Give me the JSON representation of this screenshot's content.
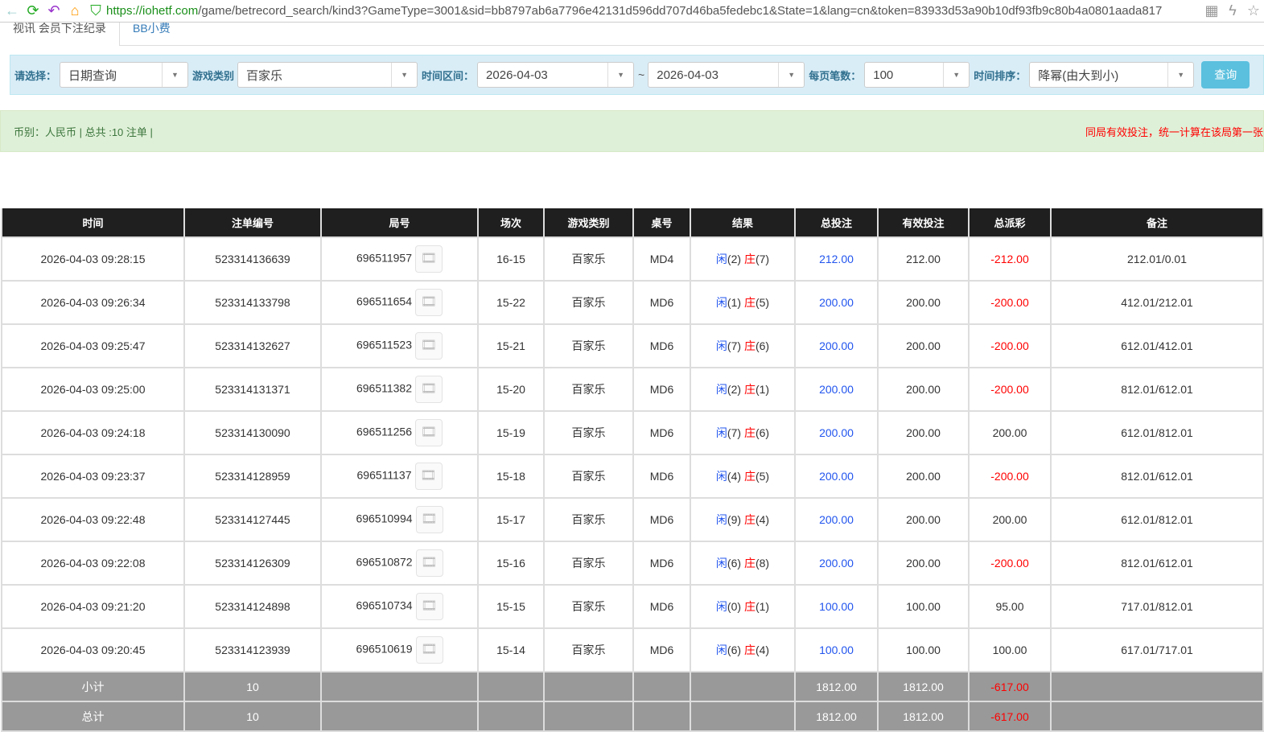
{
  "browser": {
    "url_host": "https://iohetf.com",
    "url_path": "/game/betrecord_search/kind3?GameType=3001&sid=bb8797ab6a7796e42131d596dd707d46ba5fedebc1&State=1&lang=cn&token=83933d53a90b10df93fb9c80b4a0801aada817"
  },
  "tabs": [
    {
      "label": "视讯 会员下注纪录"
    },
    {
      "label": "BB小费"
    }
  ],
  "filter": {
    "select_label": "请选择：",
    "select_value": "日期查询",
    "game_label": "游戏类别",
    "game_value": "百家乐",
    "range_label": "时间区间：",
    "date_from": "2026-04-03",
    "tilde": "~",
    "date_to": "2026-04-03",
    "per_page_label": "每页笔数：",
    "per_page_value": "100",
    "sort_label": "时间排序：",
    "sort_value": "降幂(由大到小)",
    "query_button": "查询"
  },
  "info": {
    "summary": "币别：人民币 | 总共 :10 注单 |",
    "notice": "同局有效投注，统一计算在该局第一张"
  },
  "table": {
    "headers": [
      "时间",
      "注单编号",
      "局号",
      "场次",
      "游戏类别",
      "桌号",
      "结果",
      "总投注",
      "有效投注",
      "总派彩",
      "备注"
    ],
    "rows": [
      [
        "2026-04-03 09:28:15",
        "523314136639",
        "696511957",
        "16-15",
        "百家乐",
        "MD4",
        "2",
        "7",
        "212.00",
        "212.00",
        "-212.00",
        "212.01/0.01"
      ],
      [
        "2026-04-03 09:26:34",
        "523314133798",
        "696511654",
        "15-22",
        "百家乐",
        "MD6",
        "1",
        "5",
        "200.00",
        "200.00",
        "-200.00",
        "412.01/212.01"
      ],
      [
        "2026-04-03 09:25:47",
        "523314132627",
        "696511523",
        "15-21",
        "百家乐",
        "MD6",
        "7",
        "6",
        "200.00",
        "200.00",
        "-200.00",
        "612.01/412.01"
      ],
      [
        "2026-04-03 09:25:00",
        "523314131371",
        "696511382",
        "15-20",
        "百家乐",
        "MD6",
        "2",
        "1",
        "200.00",
        "200.00",
        "-200.00",
        "812.01/612.01"
      ],
      [
        "2026-04-03 09:24:18",
        "523314130090",
        "696511256",
        "15-19",
        "百家乐",
        "MD6",
        "7",
        "6",
        "200.00",
        "200.00",
        "200.00",
        "612.01/812.01"
      ],
      [
        "2026-04-03 09:23:37",
        "523314128959",
        "696511137",
        "15-18",
        "百家乐",
        "MD6",
        "4",
        "5",
        "200.00",
        "200.00",
        "-200.00",
        "812.01/612.01"
      ],
      [
        "2026-04-03 09:22:48",
        "523314127445",
        "696510994",
        "15-17",
        "百家乐",
        "MD6",
        "9",
        "4",
        "200.00",
        "200.00",
        "200.00",
        "612.01/812.01"
      ],
      [
        "2026-04-03 09:22:08",
        "523314126309",
        "696510872",
        "15-16",
        "百家乐",
        "MD6",
        "6",
        "8",
        "200.00",
        "200.00",
        "-200.00",
        "812.01/612.01"
      ],
      [
        "2026-04-03 09:21:20",
        "523314124898",
        "696510734",
        "15-15",
        "百家乐",
        "MD6",
        "0",
        "1",
        "100.00",
        "100.00",
        "95.00",
        "717.01/812.01"
      ],
      [
        "2026-04-03 09:20:45",
        "523314123939",
        "696510619",
        "15-14",
        "百家乐",
        "MD6",
        "6",
        "4",
        "100.00",
        "100.00",
        "100.00",
        "617.01/717.01"
      ]
    ],
    "player_label": "闲",
    "banker_label": "庄",
    "subtotal": {
      "label": "小计",
      "count": "10",
      "total_bet": "1812.00",
      "valid_bet": "1812.00",
      "payout": "-617.00"
    },
    "total": {
      "label": "总计",
      "count": "10",
      "total_bet": "1812.00",
      "valid_bet": "1812.00",
      "payout": "-617.00"
    }
  },
  "colors": {
    "header_bg": "#1f1f1f",
    "blue": "#2255ee",
    "red": "#ff0000",
    "summary_bg": "#999999",
    "filter_bg": "#d9edf7",
    "info_bg": "#dff0d8",
    "button": "#5bc0de"
  }
}
